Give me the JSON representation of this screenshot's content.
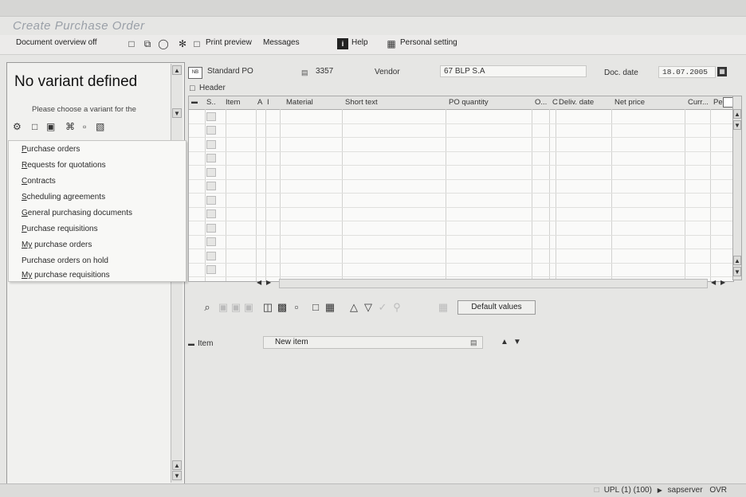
{
  "window": {
    "title": "Create Purchase Order"
  },
  "toolbar": {
    "document_overview": "Document overview off",
    "print_preview": "Print preview",
    "messages": "Messages",
    "help": "Help",
    "personal_setting": "Personal setting"
  },
  "left_panel": {
    "heading": "No variant defined",
    "hint": "Please choose a variant for the",
    "menu": [
      {
        "mnemonic": "P",
        "rest": "urchase orders"
      },
      {
        "mnemonic": "R",
        "rest": "equests for quotations"
      },
      {
        "mnemonic": "C",
        "rest": "ontracts"
      },
      {
        "mnemonic": "S",
        "rest": "cheduling agreements"
      },
      {
        "mnemonic": "G",
        "rest": "eneral purchasing documents"
      },
      {
        "mnemonic": "P",
        "rest": "urchase requisitions"
      },
      {
        "mnemonic": "My",
        "rest": " purchase orders"
      },
      {
        "mnemonic": "",
        "rest": "Purchase orders on hold"
      },
      {
        "mnemonic": "My",
        "rest": " purchase requisitions"
      }
    ]
  },
  "header": {
    "po_type": "Standard PO",
    "po_number": "3357",
    "vendor_label": "Vendor",
    "vendor_value": "67 BLP S.A",
    "doc_date_label": "Doc. date",
    "doc_date_value": "18.07.2005",
    "header_label": "Header"
  },
  "grid": {
    "columns": [
      "S..",
      "Item",
      "A",
      "I",
      "Material",
      "Short text",
      "PO quantity",
      "O...",
      "C",
      "Deliv. date",
      "Net price",
      "Curr...",
      "Per"
    ],
    "row_count": 12
  },
  "item_section": {
    "default_values": "Default values",
    "item_label": "Item",
    "item_value": "New item"
  },
  "status_bar": {
    "system": "UPL (1) (100)",
    "server": "sapserver",
    "mode": "OVR"
  }
}
